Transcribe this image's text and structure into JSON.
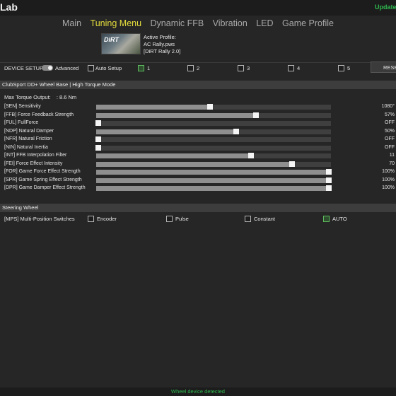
{
  "app": {
    "title": "Lab",
    "update_link": "Update"
  },
  "nav": {
    "tabs": [
      "Main",
      "Tuning Menu",
      "Dynamic FFB",
      "Vibration",
      "LED",
      "Game Profile"
    ],
    "active_index": 1
  },
  "profile": {
    "thumbnail_text": "DiRT",
    "label": "Active Profile:",
    "filename": "AC Rally.pws",
    "game": "[DiRT Rally 2.0]"
  },
  "device_setup": {
    "label": "DEVICE SETUP:",
    "advanced_label": "Advanced",
    "advanced_on": true,
    "auto_setup": {
      "label": "Auto Setup",
      "checked": false
    },
    "slots": [
      {
        "label": "1",
        "checked": true
      },
      {
        "label": "2",
        "checked": false
      },
      {
        "label": "3",
        "checked": false
      },
      {
        "label": "4",
        "checked": false
      },
      {
        "label": "5",
        "checked": false
      }
    ],
    "reset_label": "RESET"
  },
  "wheel_base": {
    "header": "ClubSport DD+ Wheel Base | High Torque Mode",
    "max_torque_label": "Max Torque Output:",
    "max_torque_value": ": 8.6 Nm",
    "sliders": [
      {
        "label": "[SEN] Sensitivity",
        "value": "1080°",
        "fraction": 0.485
      },
      {
        "label": "[FFB] Force Feedback Strength",
        "value": "57%",
        "fraction": 0.68
      },
      {
        "label": "[FUL] FullForce",
        "value": "OFF",
        "fraction": 0.01
      },
      {
        "label": "[NDP] Natural Damper",
        "value": "50%",
        "fraction": 0.595
      },
      {
        "label": "[NFR] Natural Friction",
        "value": "OFF",
        "fraction": 0.01
      },
      {
        "label": "[NIN] Natural Inertia",
        "value": "OFF",
        "fraction": 0.01
      },
      {
        "label": "[INT] FFB Interpolation Filter",
        "value": "11",
        "fraction": 0.66
      },
      {
        "label": "[FEI] Force Effect Intensity",
        "value": "70",
        "fraction": 0.835
      },
      {
        "label": "[FOR] Game Force Effect Strength",
        "value": "100%",
        "fraction": 0.99
      },
      {
        "label": "[SPR] Game Spring Effect Strength",
        "value": "100%",
        "fraction": 0.99
      },
      {
        "label": "[DPR] Game Damper Effect Strength",
        "value": "100%",
        "fraction": 0.99
      }
    ]
  },
  "steering_wheel": {
    "header": "Steering Wheel",
    "mps_label": "[MPS] Multi-Position Switches",
    "options": [
      {
        "label": "Encoder",
        "checked": false
      },
      {
        "label": "Pulse",
        "checked": false
      },
      {
        "label": "Constant",
        "checked": false
      },
      {
        "label": "AUTO",
        "checked": true
      }
    ]
  },
  "status": {
    "text": "Wheel device detected"
  },
  "colors": {
    "accent_yellow": "#e6df3c",
    "status_green": "#2fb84f",
    "background": "#262626"
  }
}
